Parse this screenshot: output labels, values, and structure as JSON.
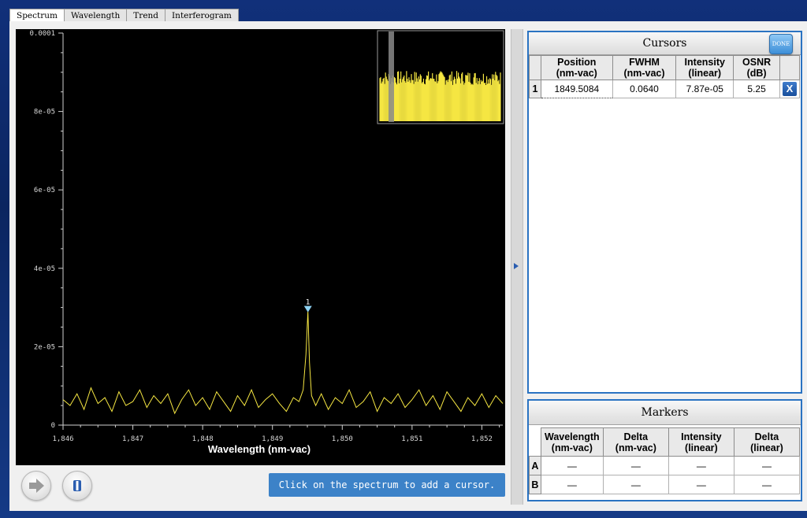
{
  "tabs": [
    {
      "label": "Spectrum",
      "active": true
    },
    {
      "label": "Wavelength",
      "active": false
    },
    {
      "label": "Trend",
      "active": false
    },
    {
      "label": "Interferogram",
      "active": false
    }
  ],
  "chart_data": {
    "type": "line",
    "xlabel": "Wavelength (nm-vac)",
    "ylabel": "",
    "xlim": [
      1846.0,
      1852.3
    ],
    "ylim": [
      0,
      0.0001
    ],
    "x_ticks": [
      "1,846",
      "1,847",
      "1,848",
      "1,849",
      "1,850",
      "1,851",
      "1,852"
    ],
    "y_ticks": [
      "0.0001",
      "8e-05",
      "6e-05",
      "4e-05",
      "2e-05",
      "0"
    ],
    "line_color": "#f5e642",
    "background": "#000000",
    "grid": false,
    "noise_floor_approx": 6e-06,
    "series": [
      {
        "x": [
          1846.0,
          1846.1,
          1846.2,
          1846.3,
          1846.4,
          1846.5,
          1846.6,
          1846.7,
          1846.8,
          1846.9,
          1847.0,
          1847.1,
          1847.2,
          1847.3,
          1847.4,
          1847.5,
          1847.6,
          1847.7,
          1847.8,
          1847.9,
          1848.0,
          1848.1,
          1848.2,
          1848.3,
          1848.4,
          1848.5,
          1848.6,
          1848.7,
          1848.8,
          1848.9,
          1849.0,
          1849.1,
          1849.2,
          1849.3,
          1849.38,
          1849.44,
          1849.48,
          1849.5084,
          1849.53,
          1849.56,
          1849.62,
          1849.7,
          1849.8,
          1849.9,
          1850.0,
          1850.1,
          1850.2,
          1850.3,
          1850.4,
          1850.5,
          1850.6,
          1850.7,
          1850.8,
          1850.9,
          1851.0,
          1851.1,
          1851.2,
          1851.3,
          1851.4,
          1851.5,
          1851.6,
          1851.7,
          1851.8,
          1851.9,
          1852.0,
          1852.1,
          1852.2,
          1852.3
        ],
        "y": [
          6.5e-06,
          5e-06,
          8e-06,
          4e-06,
          9.5e-06,
          5.5e-06,
          7e-06,
          3.5e-06,
          8.5e-06,
          5e-06,
          6e-06,
          9e-06,
          4.5e-06,
          7.5e-06,
          5.5e-06,
          8e-06,
          3e-06,
          6.5e-06,
          9e-06,
          5e-06,
          7e-06,
          4e-06,
          8.5e-06,
          6e-06,
          3.5e-06,
          7.5e-06,
          5e-06,
          9e-06,
          4.5e-06,
          6.5e-06,
          8e-06,
          5.5e-06,
          3.5e-06,
          7e-06,
          6e-06,
          9e-06,
          1.8e-05,
          2.9e-05,
          1.6e-05,
          7.5e-06,
          5e-06,
          8e-06,
          4e-06,
          7e-06,
          5.5e-06,
          9e-06,
          4.5e-06,
          6e-06,
          8.5e-06,
          3.5e-06,
          7e-06,
          5.5e-06,
          8e-06,
          4.5e-06,
          6.5e-06,
          9e-06,
          5e-06,
          7.5e-06,
          4e-06,
          8.5e-06,
          6e-06,
          3.5e-06,
          7e-06,
          5e-06,
          8e-06,
          4.5e-06,
          7.5e-06,
          5.5e-06
        ]
      }
    ],
    "cursor_label": "1",
    "cursor_x": 1849.5084,
    "cursor_y": 2.9e-05
  },
  "buttons": {
    "forward_icon": "arrow-right-icon",
    "pause_icon": "pause-icon",
    "hint": "Click on the spectrum to add a cursor."
  },
  "cursors": {
    "title": "Cursors",
    "done_label": "DONE",
    "columns": [
      {
        "l1": "Position",
        "l2": "(nm-vac)"
      },
      {
        "l1": "FWHM",
        "l2": "(nm-vac)"
      },
      {
        "l1": "Intensity",
        "l2": "(linear)"
      },
      {
        "l1": "OSNR",
        "l2": "(dB)"
      }
    ],
    "rows": [
      {
        "id": "1",
        "position": "1849.5084",
        "fwhm": "0.0640",
        "intensity": "7.87e-05",
        "osnr": "5.25",
        "remove": "X"
      }
    ]
  },
  "markers": {
    "title": "Markers",
    "columns": [
      {
        "l1": "Wavelength",
        "l2": "(nm-vac)"
      },
      {
        "l1": "Delta",
        "l2": "(nm-vac)"
      },
      {
        "l1": "Intensity",
        "l2": "(linear)"
      },
      {
        "l1": "Delta",
        "l2": "(linear)"
      }
    ],
    "rows": [
      {
        "id": "A",
        "values": [
          "—",
          "—",
          "—",
          "—"
        ]
      },
      {
        "id": "B",
        "values": [
          "—",
          "—",
          "—",
          "—"
        ]
      }
    ]
  },
  "colors": {
    "accent": "#2a73c2",
    "hint_bg": "#3c82c8",
    "trace": "#f5e642"
  }
}
